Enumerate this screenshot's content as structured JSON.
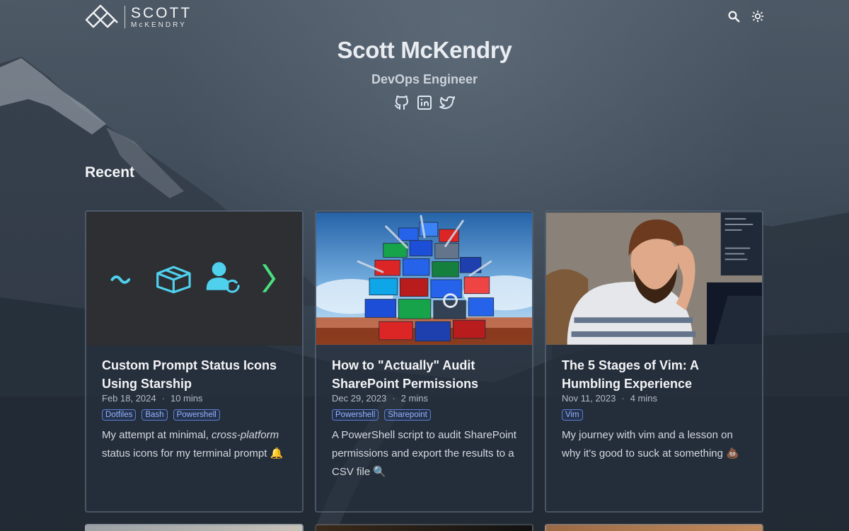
{
  "header": {
    "logo_name": "SCOTT",
    "logo_sub": "McKENDRY",
    "icons": [
      "search-icon",
      "theme-toggle-icon"
    ]
  },
  "hero": {
    "name": "Scott McKendry",
    "role": "DevOps Engineer",
    "socials": [
      "github-icon",
      "linkedin-icon",
      "twitter-icon"
    ]
  },
  "section": {
    "title": "Recent"
  },
  "cards": [
    {
      "title": "Custom Prompt Status Icons Using Starship",
      "date": "Feb 18, 2024",
      "read": "10 mins",
      "tags": [
        "Dotfiles",
        "Bash",
        "Powershell"
      ],
      "desc_pre": "My attempt at minimal, ",
      "desc_em": "cross-platform",
      "desc_post": " status icons for my terminal prompt 🔔",
      "image": "prompt-icons"
    },
    {
      "title": "How to \"Actually\" Audit SharePoint Permissions",
      "date": "Dec 29, 2023",
      "read": "2 mins",
      "tags": [
        "Powershell",
        "Sharepoint"
      ],
      "desc": "A PowerShell script to audit SharePoint permissions and export the results to a CSV file 🔍",
      "image": "sharepoint-pile"
    },
    {
      "title": "The 5 Stages of Vim: A Humbling Experience",
      "date": "Nov 11, 2023",
      "read": "4 mins",
      "tags": [
        "Vim"
      ],
      "desc": "My journey with vim and a lesson on why it's good to suck at something 💩",
      "image": "frustrated-dev"
    }
  ],
  "colors": {
    "accent_tag": "#93b4ff",
    "icon_cyan": "#4fd1ee",
    "icon_green": "#4ade80"
  }
}
